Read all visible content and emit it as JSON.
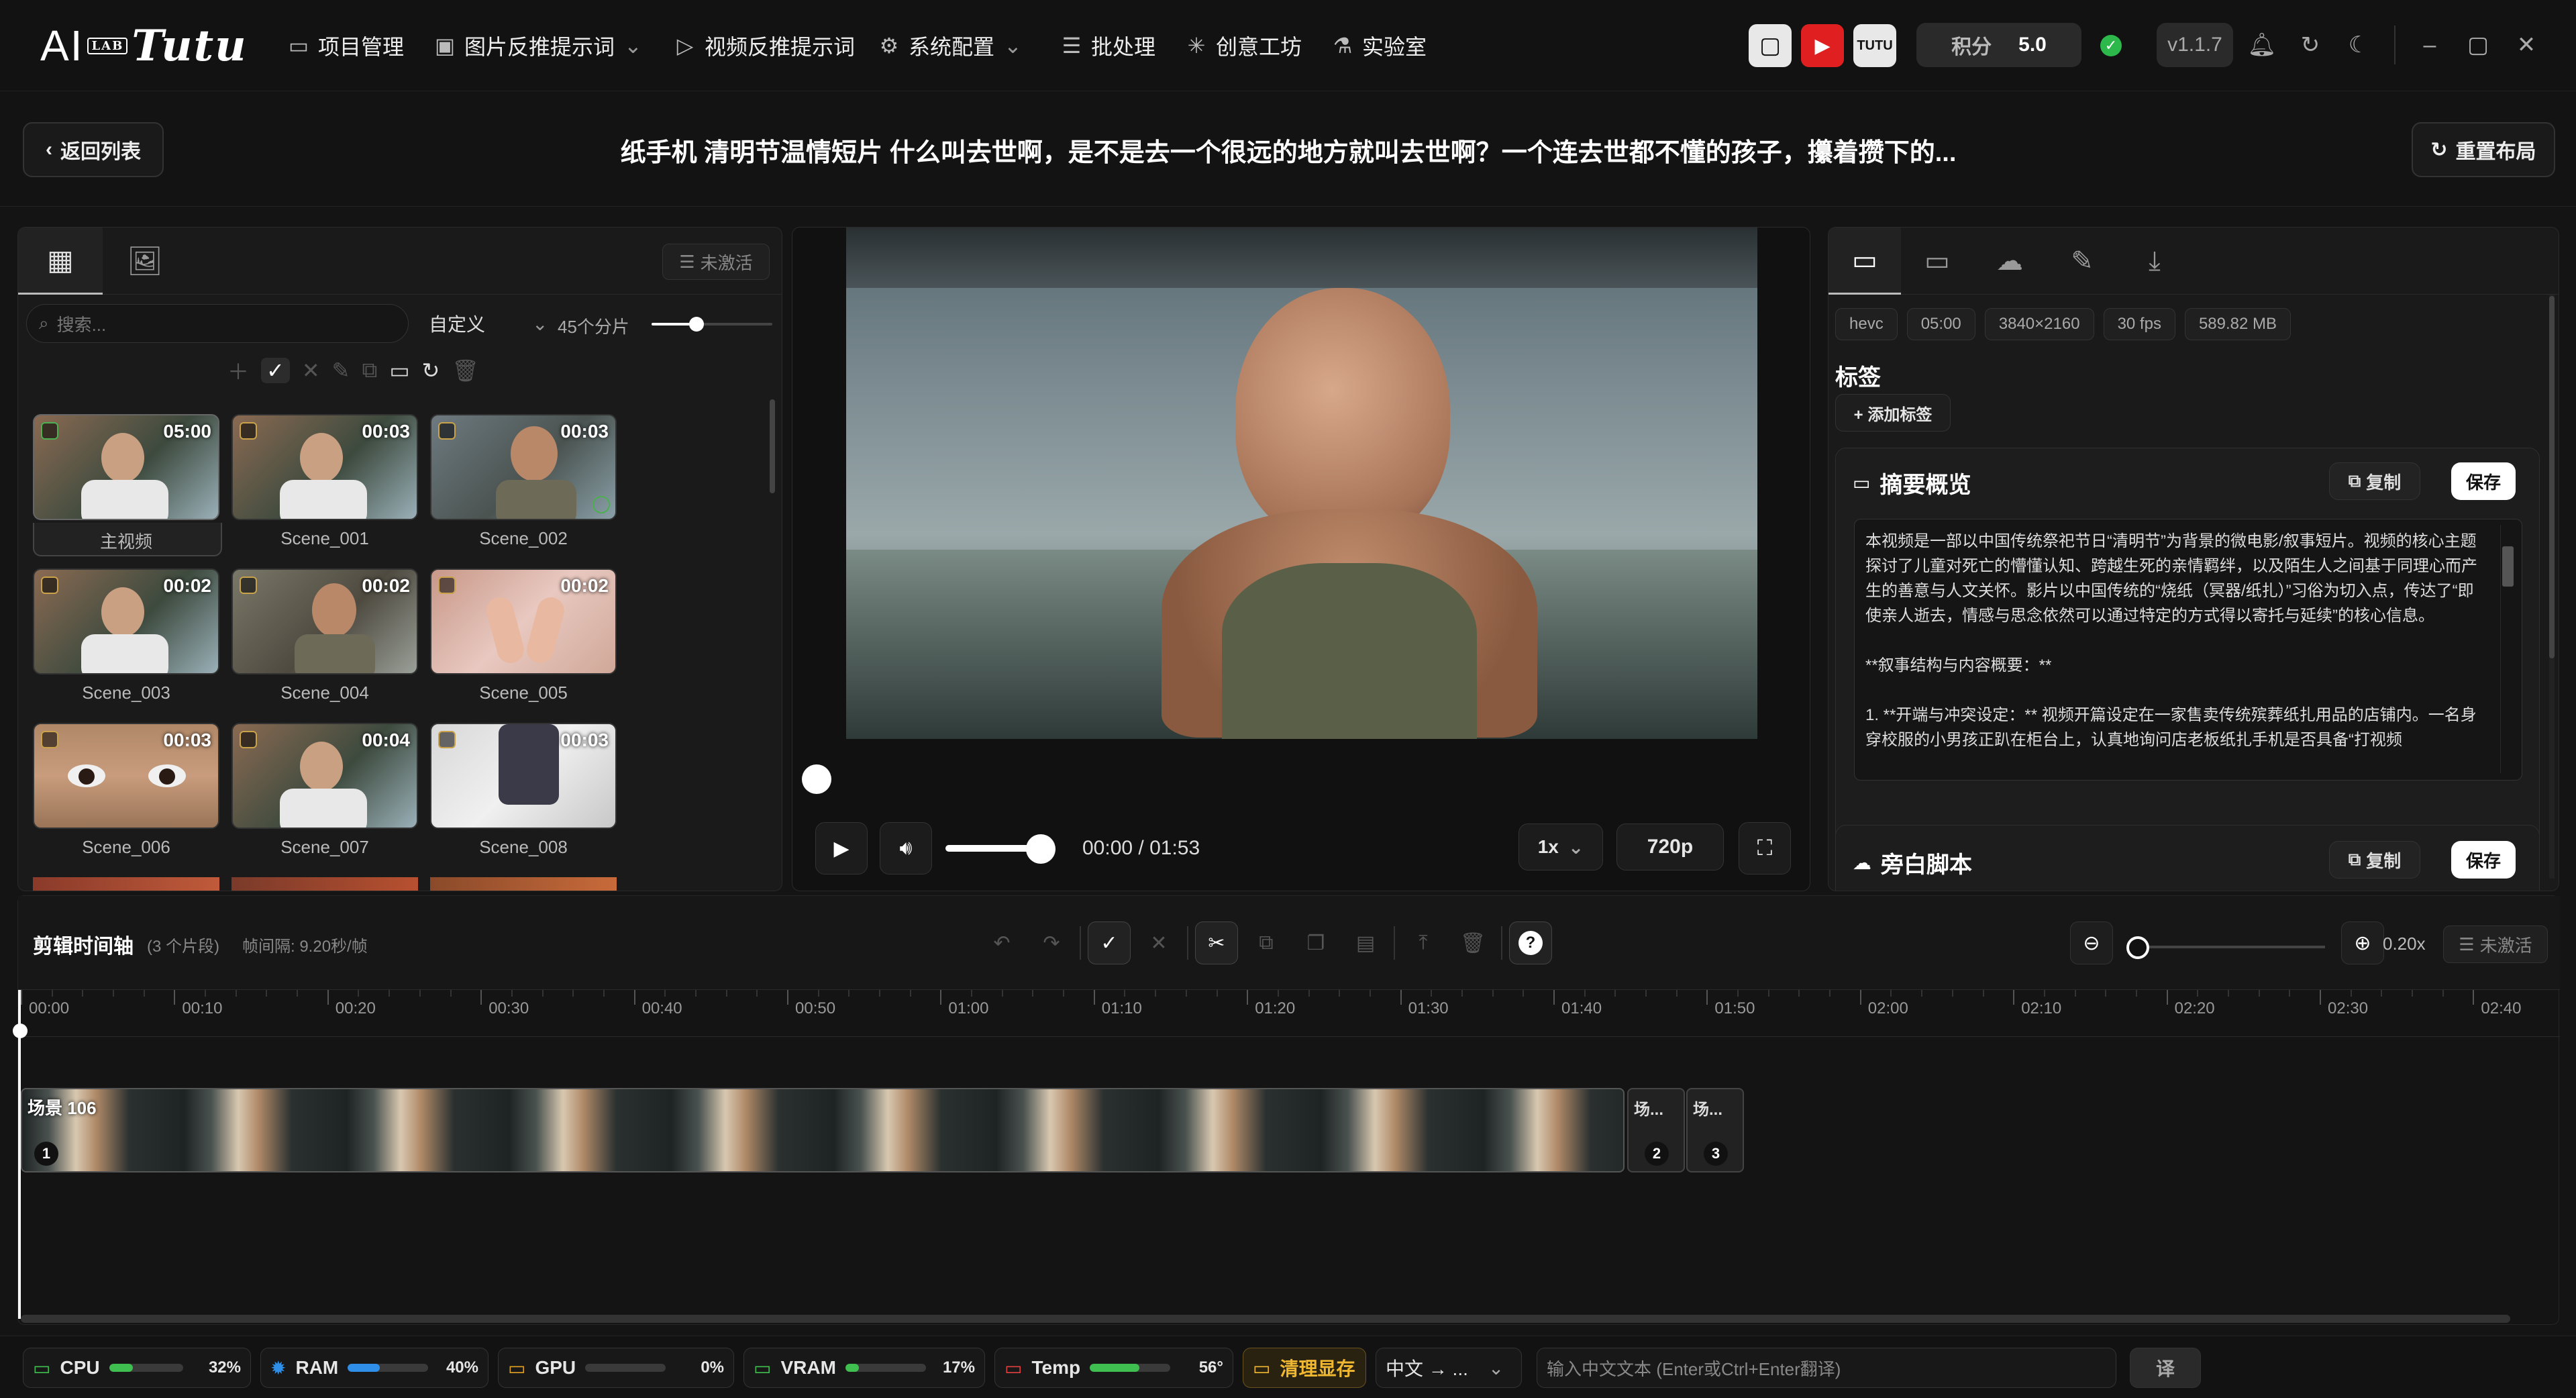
{
  "app": {
    "logo": "AI",
    "logo_badge": "LAB",
    "logo_script": "Tutu"
  },
  "nav": [
    {
      "label": "项目管理",
      "icon": "folder-icon"
    },
    {
      "label": "图片反推提示词",
      "icon": "image-icon",
      "has_dropdown": true
    },
    {
      "label": "视频反推提示词",
      "icon": "play-circle-icon"
    },
    {
      "label": "系统配置",
      "icon": "gear-icon",
      "has_dropdown": true
    },
    {
      "label": "批处理",
      "icon": "sliders-icon"
    },
    {
      "label": "创意工坊",
      "icon": "sparkle-icon"
    },
    {
      "label": "实验室",
      "icon": "flask-icon"
    }
  ],
  "score": {
    "label": "积分",
    "value": "5.0"
  },
  "version": "v1.1.7",
  "header": {
    "back_label": "返回列表",
    "title": "纸手机 清明节温情短片 什么叫去世啊，是不是去一个很远的地方就叫去世啊？一个连去世都不懂的孩子，攥着攒下的...",
    "reset_label": "重置布局"
  },
  "left_panel": {
    "inactive_label": "未激活",
    "search_placeholder": "搜索...",
    "filter_value": "自定义",
    "split_count": "45个分片",
    "clips": [
      {
        "name": "主视频",
        "duration": "05:00",
        "selected": true
      },
      {
        "name": "Scene_001",
        "duration": "00:03"
      },
      {
        "name": "Scene_002",
        "duration": "00:03"
      },
      {
        "name": "Scene_003",
        "duration": "00:02"
      },
      {
        "name": "Scene_004",
        "duration": "00:02"
      },
      {
        "name": "Scene_005",
        "duration": "00:02"
      },
      {
        "name": "Scene_006",
        "duration": "00:03"
      },
      {
        "name": "Scene_007",
        "duration": "00:04"
      },
      {
        "name": "Scene_008",
        "duration": "00:03"
      }
    ]
  },
  "player": {
    "time": "00:00 / 01:53",
    "speed": "1x",
    "quality": "720p",
    "progress_fraction": 0.0,
    "volume_fraction": 1.0
  },
  "right_panel": {
    "meta": [
      "hevc",
      "05:00",
      "3840×2160",
      "30 fps",
      "589.82 MB"
    ],
    "tags_title": "标签",
    "add_tag_label": "+ 添加标签",
    "summary_title": "摘要概览",
    "copy_label": "复制",
    "save_label": "保存",
    "summary_text": "本视频是一部以中国传统祭祀节日“清明节”为背景的微电影/叙事短片。视频的核心主题探讨了儿童对死亡的懵懂认知、跨越生死的亲情羁绊，以及陌生人之间基于同理心而产生的善意与人文关怀。影片以中国传统的“烧纸（冥器/纸扎）”习俗为切入点，传达了“即使亲人逝去，情感与思念依然可以通过特定的方式得以寄托与延续”的核心信息。\n\n**叙事结构与内容概要：**\n\n1. **开端与冲突设定：** 视频开篇设定在一家售卖传统殡葬纸扎用品的店铺内。一名身穿校服的小男孩正趴在柜台上，认真地询问店老板纸扎手机是否具备“打视频",
    "narration_title": "旁白脚本"
  },
  "timeline": {
    "title": "剪辑时间轴",
    "segments_count": "(3 个片段)",
    "frame_interval": "帧间隔: 9.20秒/帧",
    "zoom": "0.20x",
    "inactive_label": "未激活",
    "ruler": [
      "00:00",
      "00:10",
      "00:20",
      "00:30",
      "00:40",
      "00:50",
      "01:00",
      "01:10",
      "01:20",
      "01:30",
      "01:40",
      "01:50",
      "02:00",
      "02:10",
      "02:20",
      "02:30",
      "02:40"
    ],
    "clips": [
      {
        "label": "场景 106",
        "index": "1"
      },
      {
        "label": "场...",
        "index": "2"
      },
      {
        "label": "场...",
        "index": "3"
      }
    ]
  },
  "status": {
    "cpu": {
      "label": "CPU",
      "value": "32%",
      "fraction": 0.32,
      "color": "#3fbf4f"
    },
    "ram": {
      "label": "RAM",
      "value": "40%",
      "fraction": 0.4,
      "color": "#2f8fe8"
    },
    "gpu": {
      "label": "GPU",
      "value": "0%",
      "fraction": 0.0,
      "color": "#e0a020"
    },
    "vram": {
      "label": "VRAM",
      "value": "17%",
      "fraction": 0.17,
      "color": "#3fbf4f"
    },
    "temp": {
      "label": "Temp",
      "value": "56°",
      "fraction": 0.62,
      "color": "#3fbf4f"
    },
    "clear_label": "清理显存",
    "lang": "中文 → ...",
    "translate_placeholder": "输入中文文本 (Enter或Ctrl+Enter翻译)",
    "translate_button": "译"
  }
}
